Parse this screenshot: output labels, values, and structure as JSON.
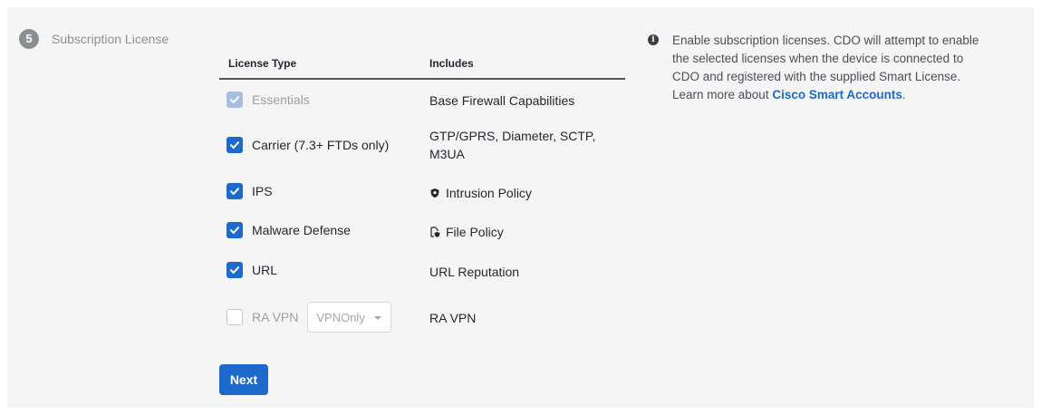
{
  "step": {
    "number": "5",
    "label": "Subscription License"
  },
  "table": {
    "headers": {
      "license_type": "License Type",
      "includes": "Includes"
    },
    "rows": [
      {
        "label": "Essentials",
        "state": "checked-disabled",
        "includes": "Base Firewall Capabilities",
        "includes_icon": ""
      },
      {
        "label": "Carrier (7.3+ FTDs only)",
        "state": "checked",
        "includes_line1": "GTP/GPRS, Diameter, SCTP,",
        "includes_line2": "M3UA",
        "includes_icon": ""
      },
      {
        "label": "IPS",
        "state": "checked",
        "includes": "Intrusion Policy",
        "includes_icon": "intrusion-shield-icon"
      },
      {
        "label": "Malware Defense",
        "state": "checked",
        "includes": "File Policy",
        "includes_icon": "file-shield-icon"
      },
      {
        "label": "URL",
        "state": "checked",
        "includes": "URL Reputation",
        "includes_icon": ""
      },
      {
        "label": "RA VPN",
        "state": "unchecked-disabled",
        "select_value": "VPNOnly",
        "includes": "RA VPN",
        "includes_icon": ""
      }
    ]
  },
  "next_button": {
    "label": "Next"
  },
  "info": {
    "icon": "info-icon",
    "text": "Enable subscription licenses. CDO will attempt to enable the selected licenses when the device is connected to CDO and registered with the supplied Smart License.",
    "learn_more": "Learn more about ",
    "link_text": "Cisco Smart Accounts",
    "link_suffix": "."
  },
  "colors": {
    "accent": "#1d69cc",
    "panel_bg": "#f5f5f6"
  }
}
